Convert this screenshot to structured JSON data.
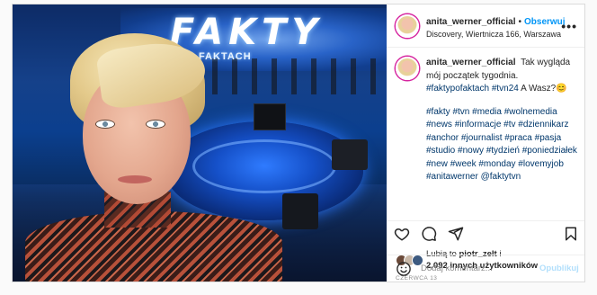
{
  "post": {
    "photo_overlay_logo": "FAKTY",
    "photo_overlay_sub": "PO FAKTACH"
  },
  "header": {
    "username": "anita_werner_official",
    "separator": "•",
    "follow_label": "Obserwuj",
    "location": "Discovery, Wiertnicza 166, Warszawa",
    "more_label": "•••"
  },
  "caption": {
    "username": "anita_werner_official",
    "text_1": "Tak wygląda mój początek tygodnia.",
    "tag_1": "#faktypofaktach",
    "tag_2": "#tvn24",
    "text_2": "A Wasz?",
    "emoji": "😊",
    "hashtags": [
      "#fakty",
      "#tvn",
      "#media",
      "#wolnemedia",
      "#news",
      "#informacje",
      "#tv",
      "#dziennikarz",
      "#anchor",
      "#journalist",
      "#praca",
      "#pasja",
      "#studio",
      "#nowy",
      "#tydzień",
      "#poniedziałek",
      "#new",
      "#week",
      "#monday",
      "#lovemyjob",
      "#anitawerner",
      "@faktytvn"
    ]
  },
  "likes": {
    "prefix": "Lubią to",
    "user": "piotr_zelt",
    "conj": "i",
    "count_text": "2,092 innych użytkowników",
    "avatar_colors": [
      "#6b4a3a",
      "#c9b8a8",
      "#3d5a80"
    ]
  },
  "date": "CZERWCA 13",
  "comment": {
    "placeholder": "Dodaj komentarz...",
    "post_label": "Opublikuj"
  },
  "icons": {
    "like": "heart-icon",
    "comment": "comment-icon",
    "share": "send-icon",
    "save": "bookmark-icon",
    "emoji": "emoji-icon"
  },
  "colors": {
    "accent_blue": "#0095f6",
    "hashtag": "#00376b",
    "story_ring": "#d6249f"
  }
}
